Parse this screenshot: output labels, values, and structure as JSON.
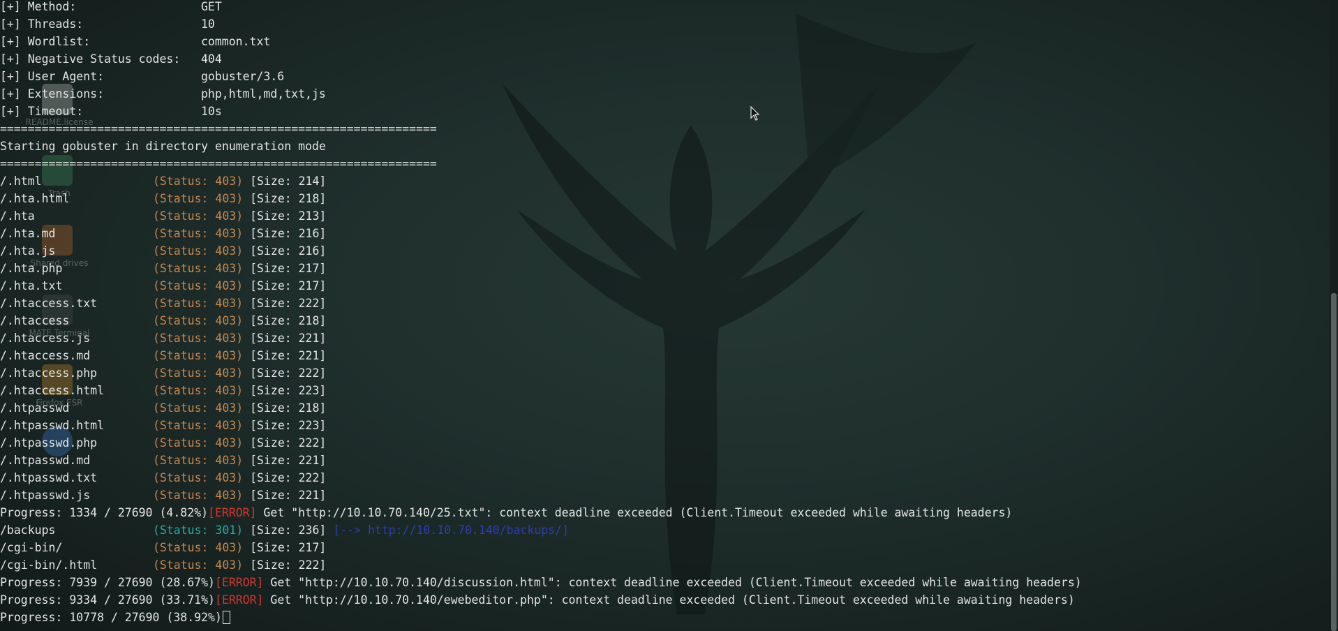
{
  "config_lines": [
    {
      "key": "[+] Method:",
      "value": "GET"
    },
    {
      "key": "[+] Threads:",
      "value": "10"
    },
    {
      "key": "[+] Wordlist:",
      "value": "common.txt"
    },
    {
      "key": "[+] Negative Status codes:",
      "value": "404"
    },
    {
      "key": "[+] User Agent:",
      "value": "gobuster/3.6"
    },
    {
      "key": "[+] Extensions:",
      "value": "php,html,md,txt,js"
    },
    {
      "key": "[+] Timeout:",
      "value": "10s"
    }
  ],
  "separator": "===============================================================",
  "mode_line": "Starting gobuster in directory enumeration mode",
  "results": [
    {
      "path": "/.html",
      "status": "(Status: 403)",
      "size": "[Size: 214]"
    },
    {
      "path": "/.hta.html",
      "status": "(Status: 403)",
      "size": "[Size: 218]"
    },
    {
      "path": "/.hta",
      "status": "(Status: 403)",
      "size": "[Size: 213]"
    },
    {
      "path": "/.hta.md",
      "status": "(Status: 403)",
      "size": "[Size: 216]"
    },
    {
      "path": "/.hta.js",
      "status": "(Status: 403)",
      "size": "[Size: 216]"
    },
    {
      "path": "/.hta.php",
      "status": "(Status: 403)",
      "size": "[Size: 217]"
    },
    {
      "path": "/.hta.txt",
      "status": "(Status: 403)",
      "size": "[Size: 217]"
    },
    {
      "path": "/.htaccess.txt",
      "status": "(Status: 403)",
      "size": "[Size: 222]"
    },
    {
      "path": "/.htaccess",
      "status": "(Status: 403)",
      "size": "[Size: 218]"
    },
    {
      "path": "/.htaccess.js",
      "status": "(Status: 403)",
      "size": "[Size: 221]"
    },
    {
      "path": "/.htaccess.md",
      "status": "(Status: 403)",
      "size": "[Size: 221]"
    },
    {
      "path": "/.htaccess.php",
      "status": "(Status: 403)",
      "size": "[Size: 222]"
    },
    {
      "path": "/.htaccess.html",
      "status": "(Status: 403)",
      "size": "[Size: 223]"
    },
    {
      "path": "/.htpasswd",
      "status": "(Status: 403)",
      "size": "[Size: 218]"
    },
    {
      "path": "/.htpasswd.html",
      "status": "(Status: 403)",
      "size": "[Size: 223]"
    },
    {
      "path": "/.htpasswd.php",
      "status": "(Status: 403)",
      "size": "[Size: 222]"
    },
    {
      "path": "/.htpasswd.md",
      "status": "(Status: 403)",
      "size": "[Size: 221]"
    },
    {
      "path": "/.htpasswd.txt",
      "status": "(Status: 403)",
      "size": "[Size: 222]"
    },
    {
      "path": "/.htpasswd.js",
      "status": "(Status: 403)",
      "size": "[Size: 221]"
    }
  ],
  "progress_1": {
    "progress": "Progress: 1334 / 27690 (4.82%)",
    "error_tag": "[ERROR]",
    "message": " Get \"http://10.10.70.140/25.txt\": context deadline exceeded (Client.Timeout exceeded while awaiting headers)"
  },
  "backups": {
    "path": "/backups",
    "status": "(Status: 301)",
    "size": "[Size: 236]",
    "redirect": "[--> http://10.10.70.140/backups/]"
  },
  "cgi_bin": {
    "path": "/cgi-bin/",
    "status": "(Status: 403)",
    "size": "[Size: 217]"
  },
  "cgi_bin_html": {
    "path": "/cgi-bin/.html",
    "status": "(Status: 403)",
    "size": "[Size: 222]"
  },
  "progress_2": {
    "progress": "Progress: 7939 / 27690 (28.67%)",
    "error_tag": "[ERROR]",
    "message": " Get \"http://10.10.70.140/discussion.html\": context deadline exceeded (Client.Timeout exceeded while awaiting headers)"
  },
  "progress_3": {
    "progress": "Progress: 9334 / 27690 (33.71%)",
    "error_tag": "[ERROR]",
    "message": " Get \"http://10.10.70.140/ewebeditor.php\": context deadline exceeded (Client.Timeout exceeded while awaiting headers)"
  },
  "progress_current": "Progress: 10778 / 27690 (38.92%)",
  "desktop_icons": [
    "README.license",
    "Trash",
    "Shared drives",
    "MATE Terminal",
    "Firefox ESR"
  ],
  "colors": {
    "status_403": "#c9874c",
    "status_301": "#2fa8a5",
    "error": "#d3362d",
    "redirect": "#2a3fb2"
  }
}
